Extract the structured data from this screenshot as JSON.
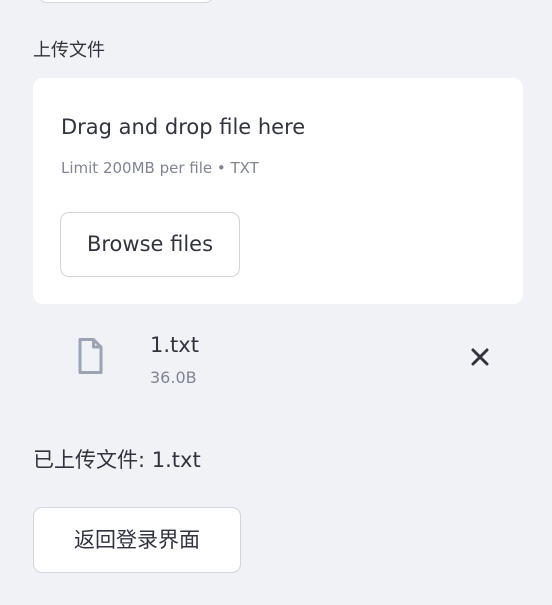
{
  "uploader": {
    "label": "上传文件",
    "drop_title": "Drag and drop file here",
    "limit_text": "Limit 200MB per file • TXT",
    "browse_label": "Browse files"
  },
  "uploaded_file": {
    "name": "1.txt",
    "size": "36.0B",
    "icon": "file-icon",
    "remove_icon": "close-icon"
  },
  "status": {
    "uploaded_text": "已上传文件: 1.txt"
  },
  "actions": {
    "back_to_login_label": "返回登录界面"
  },
  "colors": {
    "background": "#f0f2f6",
    "card": "#ffffff",
    "text": "#31333f",
    "muted_text": "#808495",
    "border": "#d1d5dc"
  }
}
